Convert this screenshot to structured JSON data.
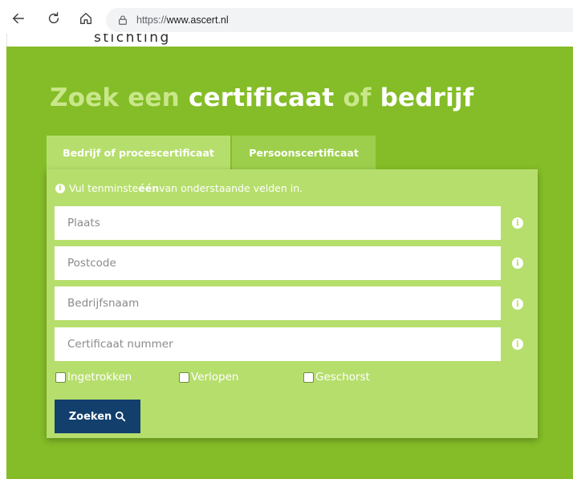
{
  "browser": {
    "url_protocol": "https://",
    "url_host": "www.ascert.nl"
  },
  "header": {
    "logo_text": "stichting"
  },
  "hero": {
    "title_part1": "Zoek een ",
    "title_part2": "certificaat",
    "title_part3": " of ",
    "title_part4": "bedrijf"
  },
  "tabs": [
    {
      "label": "Bedrijf of procescertificaat",
      "active": true
    },
    {
      "label": "Persoonscertificaat",
      "active": false
    }
  ],
  "form": {
    "hint_before": "Vul tenminste ",
    "hint_bold": "één",
    "hint_after": " van onderstaande velden in.",
    "fields": [
      {
        "placeholder": "Plaats",
        "value": ""
      },
      {
        "placeholder": "Postcode",
        "value": ""
      },
      {
        "placeholder": "Bedrijfsnaam",
        "value": ""
      },
      {
        "placeholder": "Certificaat nummer",
        "value": ""
      }
    ],
    "checkboxes": [
      {
        "label": "Ingetrokken",
        "checked": false
      },
      {
        "label": "Verlopen",
        "checked": false
      },
      {
        "label": "Geschorst",
        "checked": false
      }
    ],
    "search_label": "Zoeken"
  },
  "colors": {
    "hero_green": "#84bd27",
    "panel_green": "#b6de6c",
    "tab_inactive_green": "#9dcf4c",
    "title_muted": "#c9e78a",
    "button_navy": "#123f6c"
  },
  "icons": {
    "back": "arrow-left-icon",
    "reload": "reload-icon",
    "home": "home-icon",
    "lock": "lock-icon",
    "info": "info-icon",
    "search": "search-icon"
  }
}
